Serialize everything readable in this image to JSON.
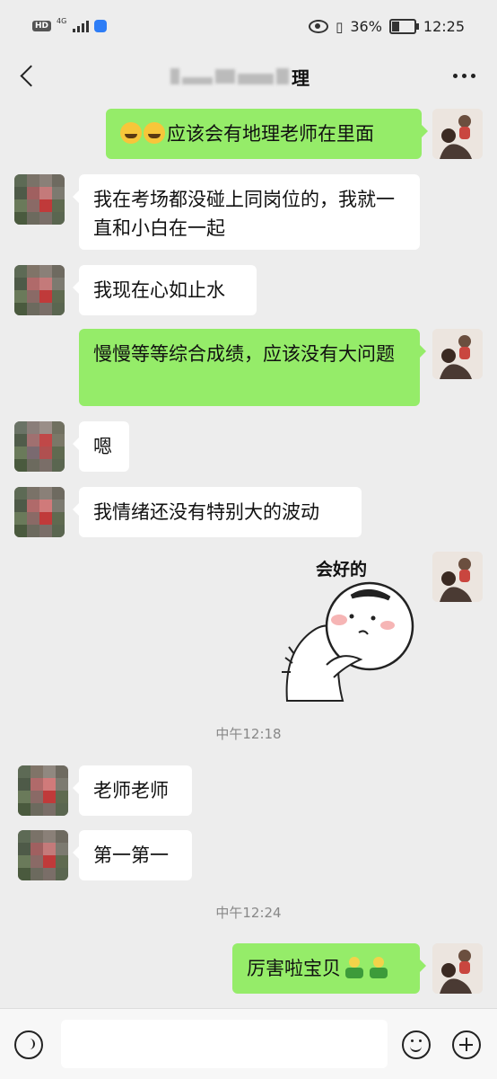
{
  "status_bar": {
    "network_badge": "HD",
    "network_type": "4G",
    "battery_percent": "36%",
    "battery_level": 0.36,
    "time": "12:25"
  },
  "header": {
    "title_suffix": "理"
  },
  "messages": [
    {
      "side": "out",
      "text": "应该会有地理老师在里面",
      "prefix_emoji": "face-with-tears-of-joy-icon x2"
    },
    {
      "side": "in",
      "text": "我在考场都没碰上同岗位的，我就一直和小白在一起"
    },
    {
      "side": "in",
      "text": "我现在心如止水"
    },
    {
      "side": "out",
      "text": "慢慢等等综合成绩，应该没有大问题"
    },
    {
      "side": "in",
      "text": "嗯"
    },
    {
      "side": "in",
      "text": "我情绪还没有特别大的波动"
    },
    {
      "side": "out",
      "type": "sticker",
      "sticker_text": "会好的"
    },
    {
      "type": "time",
      "text": "中午12:18"
    },
    {
      "side": "in",
      "text": "老师老师"
    },
    {
      "side": "in",
      "text": "第一第一"
    },
    {
      "type": "time",
      "text": "中午12:24"
    },
    {
      "side": "out",
      "text": "厉害啦宝贝",
      "suffix_emoji": "clap-icon x2"
    }
  ],
  "colors": {
    "background": "#ededed",
    "outgoing_bubble": "#95ec69",
    "incoming_bubble": "#ffffff"
  }
}
